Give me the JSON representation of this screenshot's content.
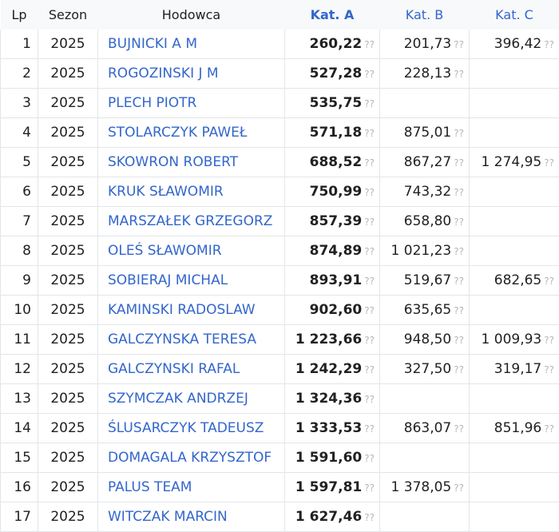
{
  "headers": {
    "lp": "Lp",
    "sezon": "Sezon",
    "hodowca": "Hodowca",
    "kat_a": "Kat. A",
    "kat_b": "Kat. B",
    "kat_c": "Kat. C"
  },
  "unknown_marker": "??",
  "rows": [
    {
      "lp": "1",
      "sezon": "2025",
      "hodowca": "BUJNICKI A M",
      "kat_a": "260,22",
      "kat_b": "201,73",
      "kat_c": "396,42"
    },
    {
      "lp": "2",
      "sezon": "2025",
      "hodowca": "ROGOZINSKI J M",
      "kat_a": "527,28",
      "kat_b": "228,13",
      "kat_c": ""
    },
    {
      "lp": "3",
      "sezon": "2025",
      "hodowca": "PLECH PIOTR",
      "kat_a": "535,75",
      "kat_b": "",
      "kat_c": ""
    },
    {
      "lp": "4",
      "sezon": "2025",
      "hodowca": "STOLARCZYK PAWEŁ",
      "kat_a": "571,18",
      "kat_b": "875,01",
      "kat_c": ""
    },
    {
      "lp": "5",
      "sezon": "2025",
      "hodowca": "SKOWRON ROBERT",
      "kat_a": "688,52",
      "kat_b": "867,27",
      "kat_c": "1 274,95"
    },
    {
      "lp": "6",
      "sezon": "2025",
      "hodowca": "KRUK SŁAWOMIR",
      "kat_a": "750,99",
      "kat_b": "743,32",
      "kat_c": ""
    },
    {
      "lp": "7",
      "sezon": "2025",
      "hodowca": "MARSZAŁEK GRZEGORZ",
      "kat_a": "857,39",
      "kat_b": "658,80",
      "kat_c": ""
    },
    {
      "lp": "8",
      "sezon": "2025",
      "hodowca": "OLEŚ SŁAWOMIR",
      "kat_a": "874,89",
      "kat_b": "1 021,23",
      "kat_c": ""
    },
    {
      "lp": "9",
      "sezon": "2025",
      "hodowca": "SOBIERAJ MICHAL",
      "kat_a": "893,91",
      "kat_b": "519,67",
      "kat_c": "682,65"
    },
    {
      "lp": "10",
      "sezon": "2025",
      "hodowca": "KAMINSKI RADOSLAW",
      "kat_a": "902,60",
      "kat_b": "635,65",
      "kat_c": ""
    },
    {
      "lp": "11",
      "sezon": "2025",
      "hodowca": "GALCZYNSKA TERESA",
      "kat_a": "1 223,66",
      "kat_b": "948,50",
      "kat_c": "1 009,93"
    },
    {
      "lp": "12",
      "sezon": "2025",
      "hodowca": "GALCZYNSKI RAFAL",
      "kat_a": "1 242,29",
      "kat_b": "327,50",
      "kat_c": "319,17"
    },
    {
      "lp": "13",
      "sezon": "2025",
      "hodowca": "SZYMCZAK ANDRZEJ",
      "kat_a": "1 324,36",
      "kat_b": "",
      "kat_c": ""
    },
    {
      "lp": "14",
      "sezon": "2025",
      "hodowca": "ŚLUSARCZYK TADEUSZ",
      "kat_a": "1 333,53",
      "kat_b": "863,07",
      "kat_c": "851,96"
    },
    {
      "lp": "15",
      "sezon": "2025",
      "hodowca": "DOMAGALA KRZYSZTOF",
      "kat_a": "1 591,60",
      "kat_b": "",
      "kat_c": ""
    },
    {
      "lp": "16",
      "sezon": "2025",
      "hodowca": "PALUS TEAM",
      "kat_a": "1 597,81",
      "kat_b": "1 378,05",
      "kat_c": ""
    },
    {
      "lp": "17",
      "sezon": "2025",
      "hodowca": "WITCZAK MARCIN",
      "kat_a": "1 627,46",
      "kat_b": "",
      "kat_c": ""
    }
  ]
}
